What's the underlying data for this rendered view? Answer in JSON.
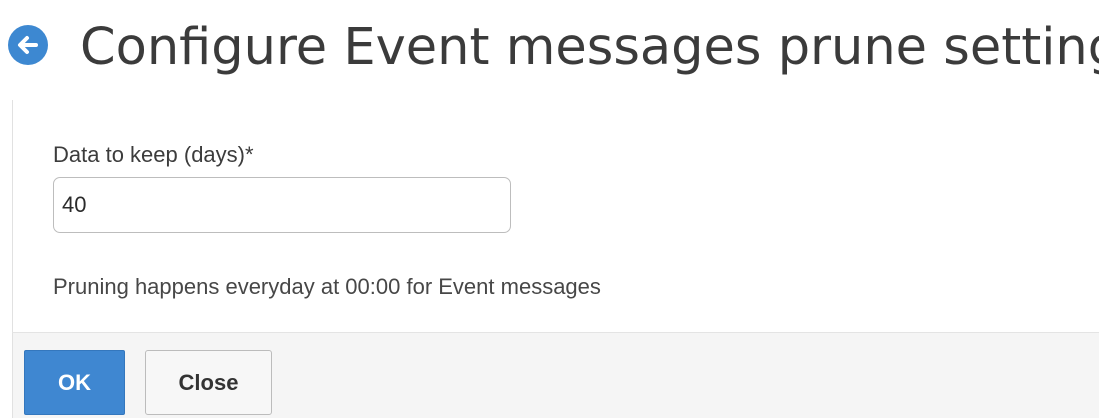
{
  "header": {
    "title": "Configure Event messages prune settings",
    "back_icon": "back-arrow-icon",
    "accent_color": "#3d88d1"
  },
  "form": {
    "field_label": "Data to keep (days)*",
    "field_value": "40",
    "info_text": "Pruning happens everyday at 00:00 for Event messages"
  },
  "footer": {
    "ok_label": "OK",
    "close_label": "Close"
  }
}
